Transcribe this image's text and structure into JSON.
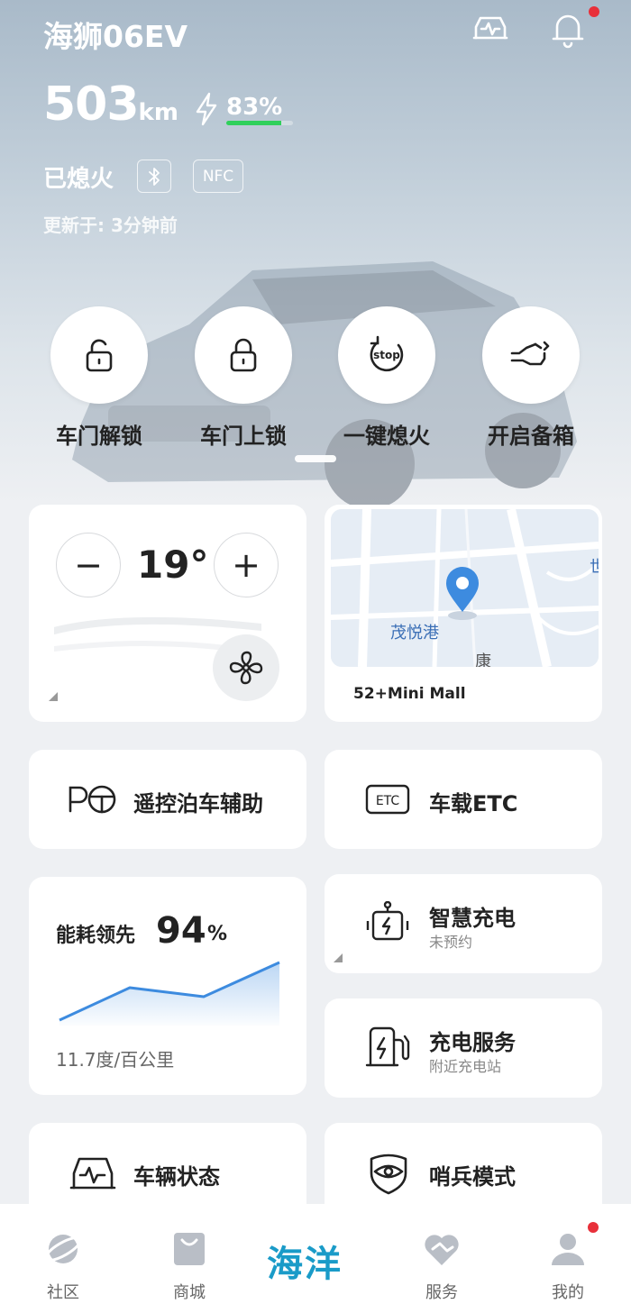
{
  "header": {
    "title": "海狮06EV",
    "range_value": "503",
    "range_unit": "km",
    "battery_label": "83%",
    "battery_percent": 83,
    "car_status": "已熄火",
    "nfc_label": "NFC",
    "updated": "更新于: 3分钟前"
  },
  "actions": [
    {
      "label": "车门解锁",
      "icon": "unlock-icon"
    },
    {
      "label": "车门上锁",
      "icon": "lock-icon"
    },
    {
      "label": "一键熄火",
      "icon": "stop-icon",
      "icon_text": "stop"
    },
    {
      "label": "开启备箱",
      "icon": "trunk-icon"
    }
  ],
  "climate": {
    "temperature": "19°",
    "minus": "−",
    "plus": "+"
  },
  "map": {
    "place_label": "茂悦港",
    "caption": "52+Mini Mall",
    "road_label_1": "世",
    "road_label_2": "康"
  },
  "features": {
    "remote_parking": "遥控泊车辅助",
    "etc": "车载ETC",
    "etc_icon_text": "ETC",
    "energy_title": "能耗领先",
    "energy_value": "94",
    "energy_unit": "%",
    "energy_stat": "11.7度/百公里",
    "smart_charge": "智慧充电",
    "smart_charge_sub": "未预约",
    "charge_service": "充电服务",
    "charge_service_sub": "附近充电站",
    "vehicle_status": "车辆状态",
    "sentry_mode": "哨兵模式"
  },
  "nav": {
    "community": "社区",
    "mall": "商城",
    "brand": "海洋",
    "service": "服务",
    "mine": "我的"
  },
  "colors": {
    "accent_blue": "#1a9bc8",
    "battery_green": "#2fd05b",
    "badge_red": "#e8303a",
    "chart_blue": "#3d8bdf"
  }
}
